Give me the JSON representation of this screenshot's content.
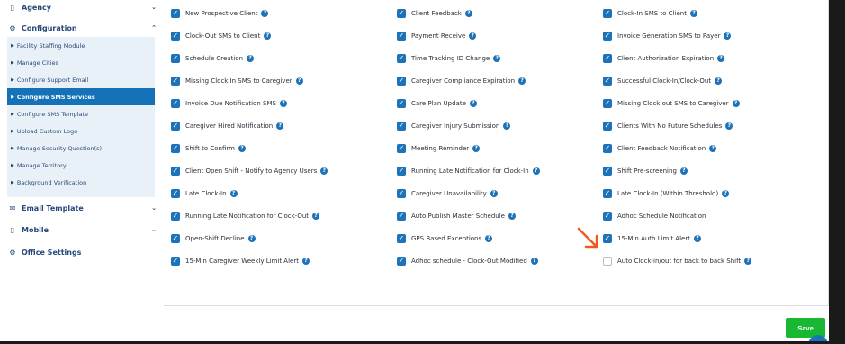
{
  "sidebar": {
    "sections": [
      {
        "label": "Agency",
        "icon": "building-icon"
      },
      {
        "label": "Configuration",
        "icon": "gears-icon"
      },
      {
        "label": "Email Template",
        "icon": "envelope-icon"
      },
      {
        "label": "Mobile",
        "icon": "mobile-icon"
      },
      {
        "label": "Office Settings",
        "icon": "gear-icon"
      }
    ],
    "config_items": [
      {
        "label": "Facility Staffing Module"
      },
      {
        "label": "Manage Cities"
      },
      {
        "label": "Configure Support Email"
      },
      {
        "label": "Configure SMS Services",
        "active": true
      },
      {
        "label": "Configure SMS Template"
      },
      {
        "label": "Upload Custom Logo"
      },
      {
        "label": "Manage Security Question(s)"
      },
      {
        "label": "Manage Territory"
      },
      {
        "label": "Background Verification"
      }
    ]
  },
  "options": {
    "col1": [
      {
        "label": "New Prospective Client",
        "checked": true
      },
      {
        "label": "Clock-Out SMS to Client",
        "checked": true
      },
      {
        "label": "Schedule Creation",
        "checked": true
      },
      {
        "label": "Missing Clock In SMS to Caregiver",
        "checked": true
      },
      {
        "label": "Invoice Due Notification SMS",
        "checked": true
      },
      {
        "label": "Caregiver Hired Notification",
        "checked": true
      },
      {
        "label": "Shift to Confirm",
        "checked": true
      },
      {
        "label": "Client Open Shift - Notify to Agency Users",
        "checked": true
      },
      {
        "label": "Late Clock-In",
        "checked": true
      },
      {
        "label": "Running Late Notification for Clock-Out",
        "checked": true
      },
      {
        "label": "Open-Shift Decline",
        "checked": true
      },
      {
        "label": "15-Min Caregiver Weekly Limit Alert",
        "checked": true
      }
    ],
    "col2": [
      {
        "label": "Client Feedback",
        "checked": true
      },
      {
        "label": "Payment Receive",
        "checked": true
      },
      {
        "label": "Time Tracking ID Change",
        "checked": true
      },
      {
        "label": "Caregiver Compliance Expiration",
        "checked": true
      },
      {
        "label": "Care Plan Update",
        "checked": true
      },
      {
        "label": "Caregiver Injury Submission",
        "checked": true
      },
      {
        "label": "Meeting Reminder",
        "checked": true
      },
      {
        "label": "Running Late Notification for Clock-In",
        "checked": true
      },
      {
        "label": "Caregiver Unavailability",
        "checked": true
      },
      {
        "label": "Auto Publish Master Schedule",
        "checked": true
      },
      {
        "label": "GPS Based Exceptions",
        "checked": true
      },
      {
        "label": "Adhoc schedule - Clock-Out Modified",
        "checked": true
      }
    ],
    "col3": [
      {
        "label": "Clock-In SMS to Client",
        "checked": true
      },
      {
        "label": "Invoice Generation SMS to Payer",
        "checked": true
      },
      {
        "label": "Client Authorization Expiration",
        "checked": true
      },
      {
        "label": "Successful Clock-In/Clock-Out",
        "checked": true
      },
      {
        "label": "Missing Clock out SMS to Caregiver",
        "checked": true
      },
      {
        "label": "Clients With No Future Schedules",
        "checked": true
      },
      {
        "label": "Client Feedback Notification",
        "checked": true
      },
      {
        "label": "Shift Pre-screening",
        "checked": true
      },
      {
        "label": "Late Clock-In (Within Threshold)",
        "checked": true
      },
      {
        "label": "Adhoc Schedule Notification",
        "checked": true,
        "no_help": true
      },
      {
        "label": "15-Min Auth Limit Alert",
        "checked": true
      },
      {
        "label": "Auto Clock-in/out for back to back Shift",
        "checked": false
      }
    ]
  },
  "save_label": "Save",
  "colors": {
    "accent": "#1c73ba",
    "save": "#19b832",
    "active_nav": "#1672b8",
    "annotation_arrow": "#ef5a23"
  }
}
